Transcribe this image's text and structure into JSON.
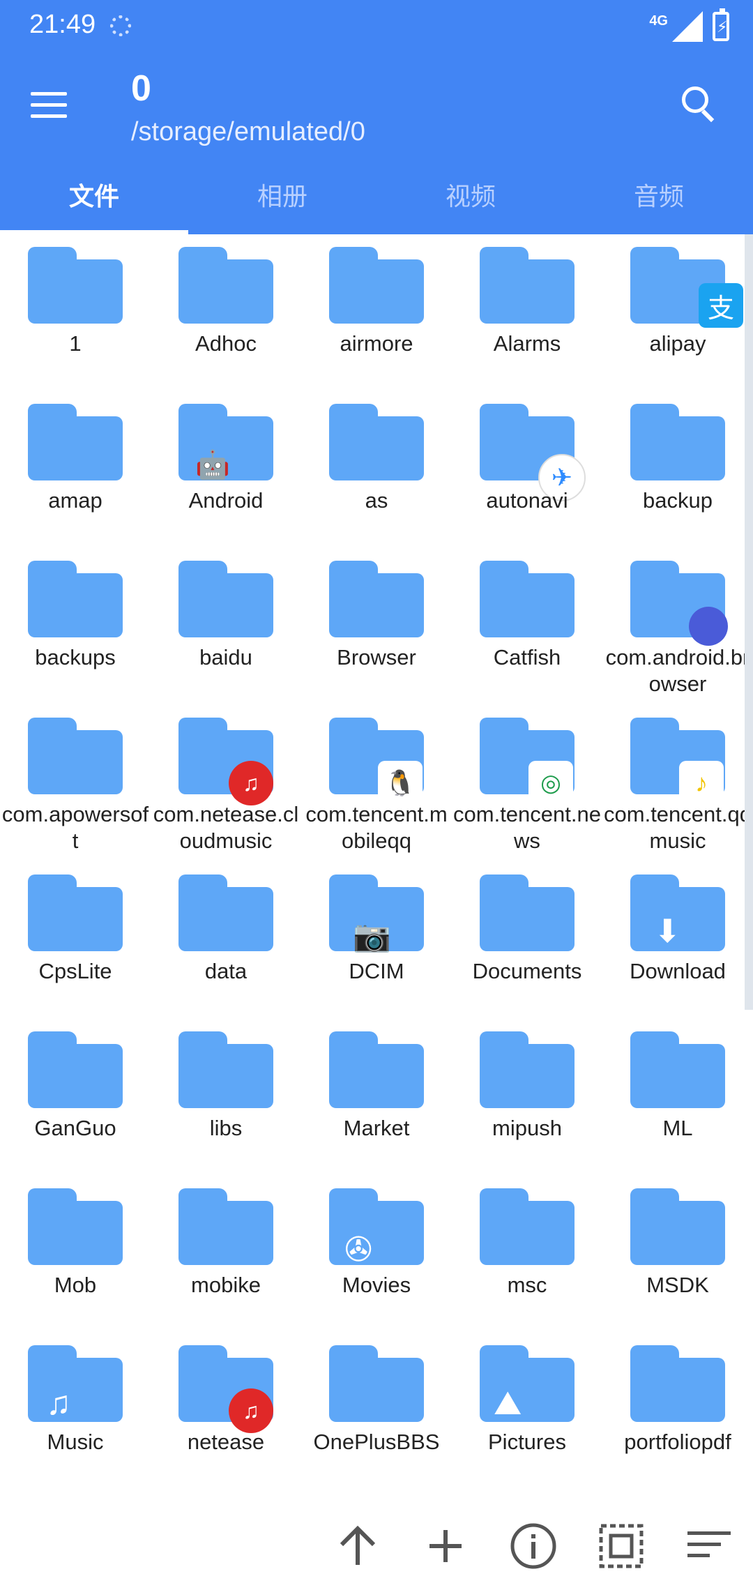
{
  "status": {
    "time": "21:49",
    "network": "4G"
  },
  "header": {
    "title": "0",
    "path": "/storage/emulated/0"
  },
  "tabs": [
    "文件",
    "相册",
    "视频",
    "音频"
  ],
  "folders": [
    "1",
    "Adhoc",
    "airmore",
    "Alarms",
    "alipay",
    "amap",
    "Android",
    "as",
    "autonavi",
    "backup",
    "backups",
    "baidu",
    "Browser",
    "Catfish",
    "com.android.browser",
    "com.apowersoft",
    "com.netease.cloudmusic",
    "com.tencent.mobileqq",
    "com.tencent.news",
    "com.tencent.qqmusic",
    "CpsLite",
    "data",
    "DCIM",
    "Documents",
    "Download",
    "GanGuo",
    "libs",
    "Market",
    "mipush",
    "ML",
    "Mob",
    "mobike",
    "Movies",
    "msc",
    "MSDK",
    "Music",
    "netease",
    "OnePlusBBS",
    "Pictures",
    "portfoliopdf"
  ],
  "colors": {
    "primary": "#4285f4",
    "folder": "#5ea7f7"
  }
}
